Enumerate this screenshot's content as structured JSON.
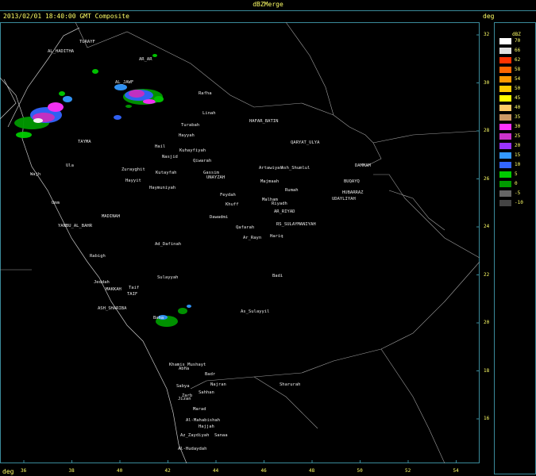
{
  "header": {
    "title": "dBZMerge",
    "subtitle": "2013/02/01 18:40:00 GMT Composite",
    "unit_right": "deg",
    "unit_bottom": "deg"
  },
  "legend": {
    "title": "dBZ",
    "items": [
      {
        "value": "70",
        "color": "#ffffff"
      },
      {
        "value": "66",
        "color": "#e0e0e0"
      },
      {
        "value": "62",
        "color": "#ff3300"
      },
      {
        "value": "58",
        "color": "#ff6600"
      },
      {
        "value": "54",
        "color": "#ff9900"
      },
      {
        "value": "50",
        "color": "#ffcc00"
      },
      {
        "value": "45",
        "color": "#ffff00"
      },
      {
        "value": "40",
        "color": "#ffcc66"
      },
      {
        "value": "35",
        "color": "#cc9966"
      },
      {
        "value": "30",
        "color": "#ff33ff"
      },
      {
        "value": "25",
        "color": "#cc33cc"
      },
      {
        "value": "20",
        "color": "#9933ff"
      },
      {
        "value": "15",
        "color": "#3399ff"
      },
      {
        "value": "10",
        "color": "#3366ff"
      },
      {
        "value": "5",
        "color": "#00cc00"
      },
      {
        "value": "0",
        "color": "#009900"
      },
      {
        "value": "-5",
        "color": "#666666"
      },
      {
        "value": "-10",
        "color": "#444444"
      }
    ]
  },
  "lat_ticks": [
    "32",
    "30",
    "28",
    "26",
    "24",
    "22",
    "20",
    "18",
    "16"
  ],
  "lon_ticks": [
    "36",
    "38",
    "40",
    "42",
    "44",
    "46",
    "48",
    "50",
    "52",
    "54"
  ],
  "cities": [
    {
      "name": "TURAYF"
    },
    {
      "name": "AL_HADITHA"
    },
    {
      "name": "AR_AR"
    },
    {
      "name": "AL_JAWF"
    },
    {
      "name": "Rafha"
    },
    {
      "name": "Linah"
    },
    {
      "name": "Turabah"
    },
    {
      "name": "HAFAR_BATIN"
    },
    {
      "name": "Hayyah"
    },
    {
      "name": "QARYAT_ULYA"
    },
    {
      "name": "TAYMA"
    },
    {
      "name": "Kuhayfiyah"
    },
    {
      "name": "Hail"
    },
    {
      "name": "Nasjid"
    },
    {
      "name": "Qiwarah"
    },
    {
      "name": "Ula"
    },
    {
      "name": "Zurayghit"
    },
    {
      "name": "Kutayfah"
    },
    {
      "name": "Gassim"
    },
    {
      "name": "Artawiyah"
    },
    {
      "name": "Ash_Shumlul"
    },
    {
      "name": "DAMMAM"
    },
    {
      "name": "Wajh"
    },
    {
      "name": "Hayyit"
    },
    {
      "name": "UNAYZAH"
    },
    {
      "name": "Majmaah"
    },
    {
      "name": "BUQAYQ"
    },
    {
      "name": "Haymuniyah"
    },
    {
      "name": "Rumah"
    },
    {
      "name": "HUBARRAZ"
    },
    {
      "name": "Feydah"
    },
    {
      "name": "Malham"
    },
    {
      "name": "UDAYLIYAH"
    },
    {
      "name": "Umm"
    },
    {
      "name": "Khuff"
    },
    {
      "name": "Riyadh"
    },
    {
      "name": "AR_RIYAD"
    },
    {
      "name": "MADINAH"
    },
    {
      "name": "Dawadmi"
    },
    {
      "name": "RS_SULAYMANIYAH"
    },
    {
      "name": "YANBU_AL_BAHR"
    },
    {
      "name": "Qafarah"
    },
    {
      "name": "Hariq"
    },
    {
      "name": "Ar_Rayn"
    },
    {
      "name": "Ad_Dafinah"
    },
    {
      "name": "Rabigh"
    },
    {
      "name": "Badi"
    },
    {
      "name": "Sulayyah"
    },
    {
      "name": "Jeddah"
    },
    {
      "name": "MAKKAH"
    },
    {
      "name": "Taif"
    },
    {
      "name": "TAIF"
    },
    {
      "name": "ASH_SHARIBA"
    },
    {
      "name": "As_Sulayyil"
    },
    {
      "name": "Baha"
    },
    {
      "name": "Khamis_Mushayt"
    },
    {
      "name": "Abha"
    },
    {
      "name": "Badr"
    },
    {
      "name": "Najran"
    },
    {
      "name": "Sharurah"
    },
    {
      "name": "Sabya"
    },
    {
      "name": "Zarb"
    },
    {
      "name": "Jizan"
    },
    {
      "name": "Sahhan"
    },
    {
      "name": "Marad"
    },
    {
      "name": "Al-Mahabishah"
    },
    {
      "name": "Hajjah"
    },
    {
      "name": "Sanaa"
    },
    {
      "name": "Az_Zaydiyah"
    },
    {
      "name": "Al-Hudaydah"
    }
  ]
}
